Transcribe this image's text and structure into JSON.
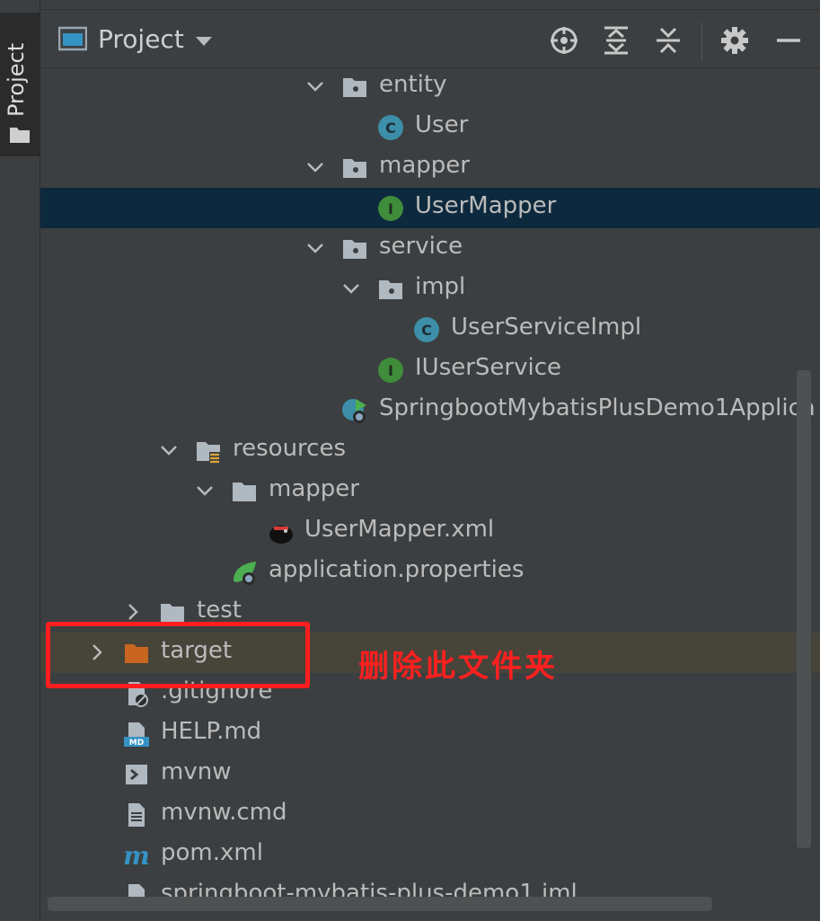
{
  "side": {
    "tab_label": "Project"
  },
  "header": {
    "title": "Project"
  },
  "tree": [
    {
      "name": "entity",
      "kind": "package",
      "indent": 335,
      "expanded": true
    },
    {
      "name": "User",
      "kind": "class",
      "indent": 375
    },
    {
      "name": "mapper",
      "kind": "package",
      "indent": 335,
      "expanded": true
    },
    {
      "name": "UserMapper",
      "kind": "interface",
      "indent": 375,
      "selected": true
    },
    {
      "name": "service",
      "kind": "package",
      "indent": 335,
      "expanded": true
    },
    {
      "name": "impl",
      "kind": "package",
      "indent": 375,
      "expanded": true
    },
    {
      "name": "UserServiceImpl",
      "kind": "class",
      "indent": 415
    },
    {
      "name": "IUserService",
      "kind": "interface",
      "indent": 375
    },
    {
      "name": "SpringbootMybatisPlusDemo1Applica",
      "kind": "springapp",
      "indent": 335
    },
    {
      "name": "resources",
      "kind": "resources",
      "indent": 172,
      "expanded": true
    },
    {
      "name": "mapper",
      "kind": "folder",
      "indent": 212,
      "expanded": true
    },
    {
      "name": "UserMapper.xml",
      "kind": "mybatis",
      "indent": 252
    },
    {
      "name": "application.properties",
      "kind": "springprops",
      "indent": 212
    },
    {
      "name": "test",
      "kind": "folder",
      "indent": 132,
      "expanded": false
    },
    {
      "name": "target",
      "kind": "excluded",
      "indent": 92,
      "expanded": false,
      "highlight": true
    },
    {
      "name": ".gitignore",
      "kind": "ignore",
      "indent": 92
    },
    {
      "name": "HELP.md",
      "kind": "markdown",
      "indent": 92
    },
    {
      "name": "mvnw",
      "kind": "shell",
      "indent": 92
    },
    {
      "name": "mvnw.cmd",
      "kind": "text",
      "indent": 92
    },
    {
      "name": "pom.xml",
      "kind": "maven",
      "indent": 92
    },
    {
      "name": "springboot-mybatis-plus-demo1.iml",
      "kind": "iml",
      "indent": 92
    }
  ],
  "annotation": {
    "text": "删除此文件夹"
  },
  "colors": {
    "selected": "#0d293e",
    "highlight": "#47443a",
    "annotation": "#ff2020",
    "class_icon": "#3d8ea8",
    "interface_icon": "#3f8c3a",
    "excluded_folder": "#c8651f"
  }
}
